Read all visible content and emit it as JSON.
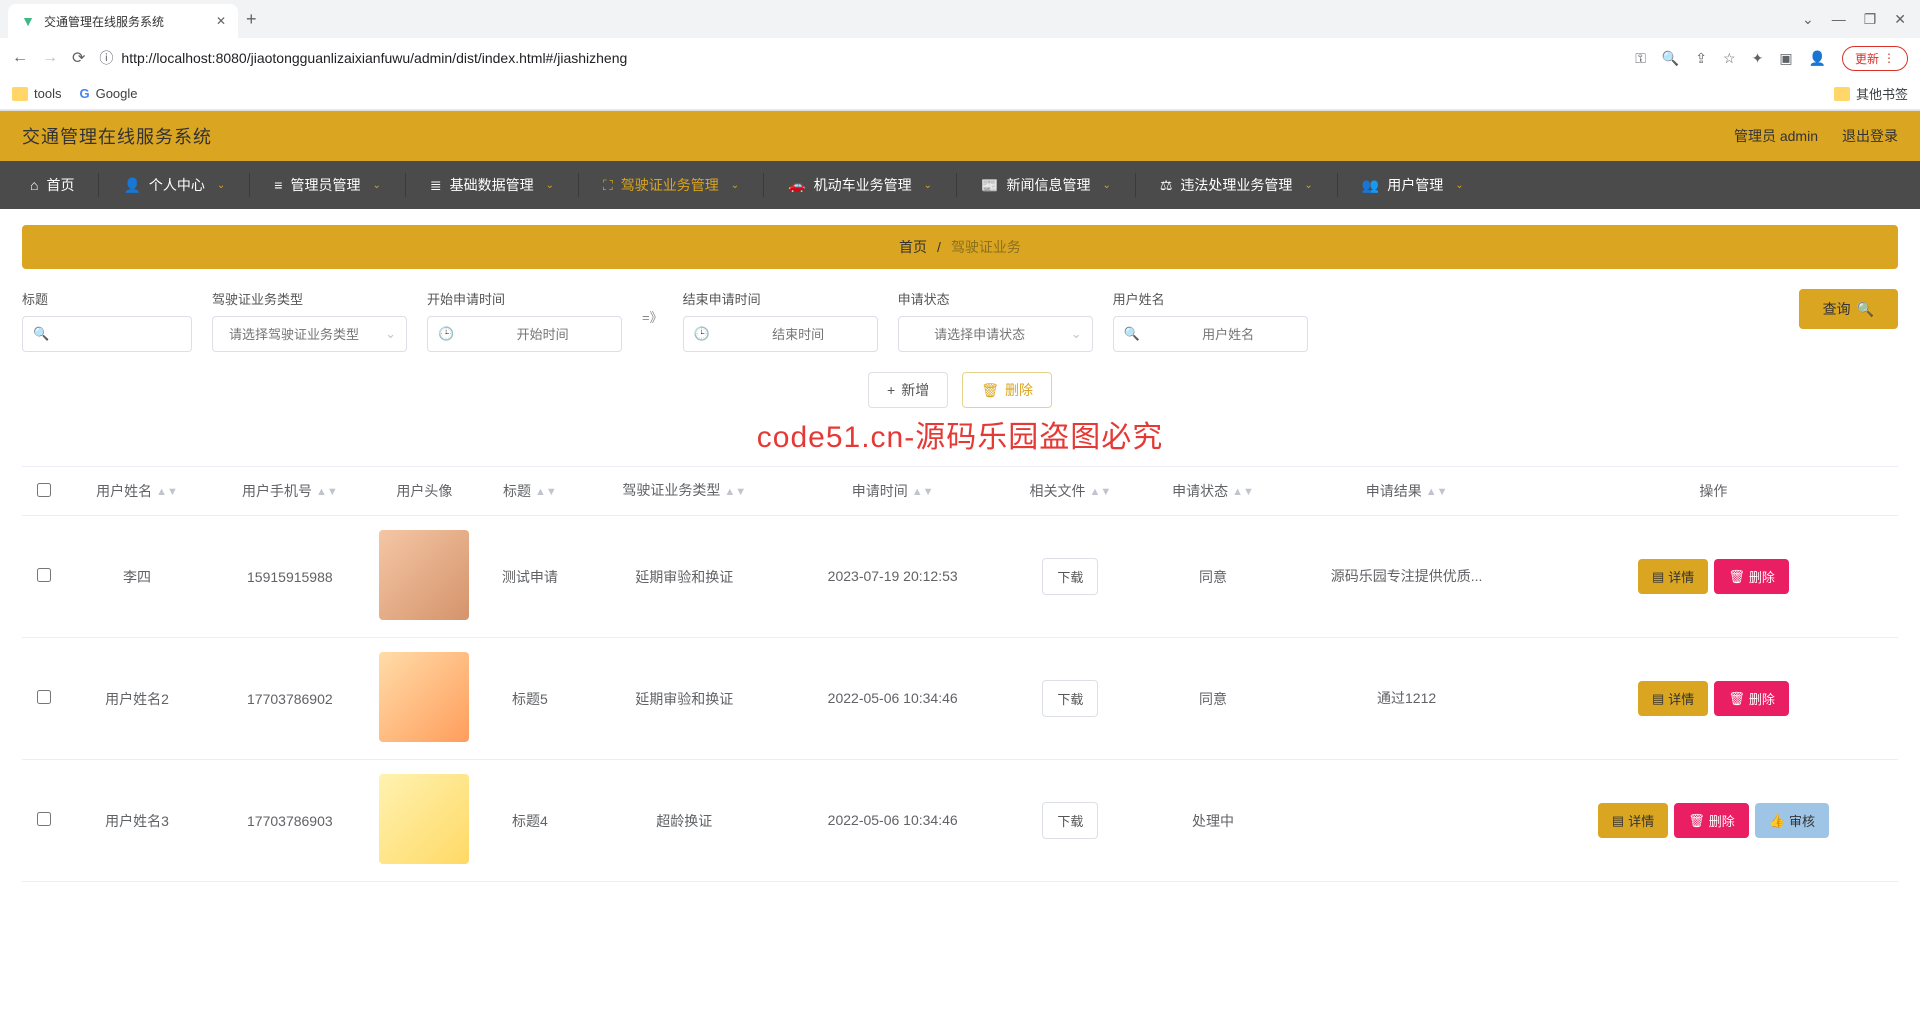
{
  "browser": {
    "tab_title": "交通管理在线服务系统",
    "url": "http://localhost:8080/jiaotongguanlizaixianfuwu/admin/dist/index.html#/jiashizheng",
    "update_label": "更新",
    "bookmarks": {
      "tools": "tools",
      "google": "Google",
      "other": "其他书签"
    }
  },
  "header": {
    "title": "交通管理在线服务系统",
    "user_label": "管理员 admin",
    "logout_label": "退出登录"
  },
  "nav": {
    "items": [
      {
        "label": "首页",
        "dropdown": false
      },
      {
        "label": "个人中心",
        "dropdown": true
      },
      {
        "label": "管理员管理",
        "dropdown": true
      },
      {
        "label": "基础数据管理",
        "dropdown": true
      },
      {
        "label": "驾驶证业务管理",
        "dropdown": true,
        "active": true
      },
      {
        "label": "机动车业务管理",
        "dropdown": true
      },
      {
        "label": "新闻信息管理",
        "dropdown": true
      },
      {
        "label": "违法处理业务管理",
        "dropdown": true
      },
      {
        "label": "用户管理",
        "dropdown": true
      }
    ]
  },
  "breadcrumb": {
    "home": "首页",
    "current": "驾驶证业务"
  },
  "search": {
    "title_label": "标题",
    "type_label": "驾驶证业务类型",
    "type_placeholder": "请选择驾驶证业务类型",
    "start_label": "开始申请时间",
    "start_placeholder": "开始时间",
    "range_sep": "=》",
    "end_label": "结束申请时间",
    "end_placeholder": "结束时间",
    "status_label": "申请状态",
    "status_placeholder": "请选择申请状态",
    "username_label": "用户姓名",
    "username_placeholder": "用户姓名",
    "query_btn": "查询"
  },
  "actions": {
    "add": "新增",
    "delete": "删除"
  },
  "watermark": "code51.cn-源码乐园盗图必究",
  "table": {
    "headers": {
      "username": "用户姓名",
      "phone": "用户手机号",
      "avatar": "用户头像",
      "title": "标题",
      "type": "驾驶证业务类型",
      "apply_time": "申请时间",
      "file": "相关文件",
      "status": "申请状态",
      "result": "申请结果",
      "ops": "操作"
    },
    "download_label": "下载",
    "detail_label": "详情",
    "delete_label": "删除",
    "audit_label": "审核",
    "rows": [
      {
        "username": "李四",
        "phone": "15915915988",
        "title": "测试申请",
        "type": "延期审验和换证",
        "apply_time": "2023-07-19 20:12:53",
        "status": "同意",
        "result": "源码乐园专注提供优质...",
        "audit": false
      },
      {
        "username": "用户姓名2",
        "phone": "17703786902",
        "title": "标题5",
        "type": "延期审验和换证",
        "apply_time": "2022-05-06 10:34:46",
        "status": "同意",
        "result": "通过1212",
        "audit": false
      },
      {
        "username": "用户姓名3",
        "phone": "17703786903",
        "title": "标题4",
        "type": "超龄换证",
        "apply_time": "2022-05-06 10:34:46",
        "status": "处理中",
        "result": "",
        "audit": true
      }
    ]
  }
}
